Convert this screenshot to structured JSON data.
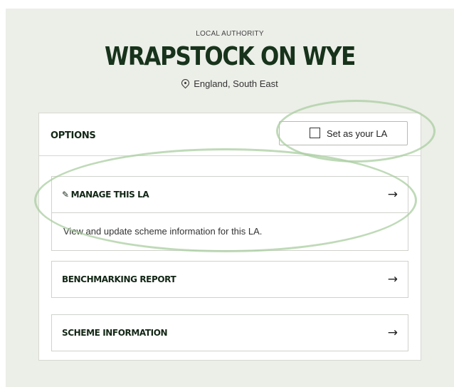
{
  "header": {
    "eyebrow": "LOCAL AUTHORITY",
    "title": "WRAPSTOCK ON WYE",
    "region": "England, South East"
  },
  "options": {
    "label": "OPTIONS",
    "set_la_label": "Set as your LA",
    "set_la_checked": false
  },
  "cards": [
    {
      "title": "MANAGE THIS LA",
      "description": "View and update scheme information for this LA.",
      "icon": "pencil-icon"
    },
    {
      "title": "BENCHMARKING REPORT",
      "icon": ""
    },
    {
      "title": "SCHEME INFORMATION",
      "icon": ""
    }
  ],
  "arrow_glyph": "→",
  "colors": {
    "page_bg": "#eceee8",
    "title": "#17331b",
    "highlight_ring": "#aacda0"
  }
}
